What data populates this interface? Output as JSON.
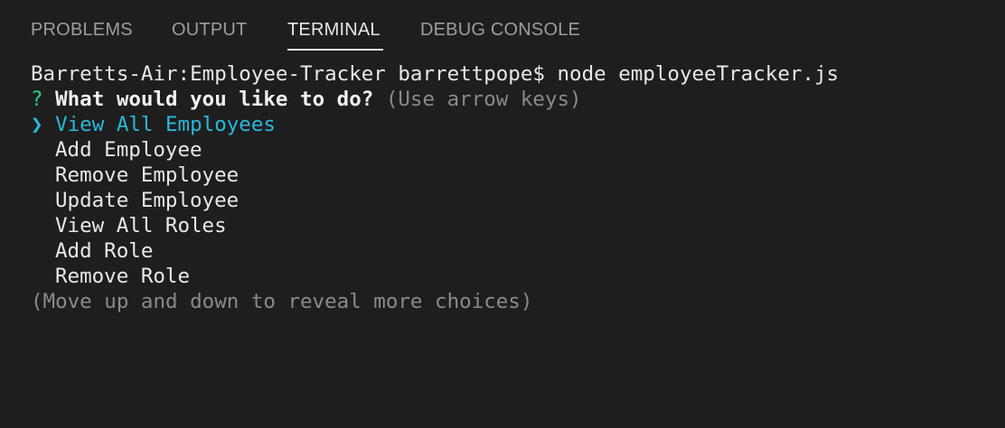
{
  "panel": {
    "tabs": [
      {
        "label": "PROBLEMS"
      },
      {
        "label": "OUTPUT"
      },
      {
        "label": "TERMINAL"
      },
      {
        "label": "DEBUG CONSOLE"
      }
    ],
    "active_tab": "TERMINAL"
  },
  "terminal": {
    "command_line": "Barretts-Air:Employee-Tracker barrettpope$ node employeeTracker.js",
    "prompt_symbol": "?",
    "question": "What would you like to do?",
    "question_hint": "(Use arrow keys)",
    "pointer_symbol": "❯",
    "selected_choice": "View All Employees",
    "choices": [
      "Add Employee",
      "Remove Employee",
      "Update Employee",
      "View All Roles",
      "Add Role",
      "Remove Role"
    ],
    "footer_hint": "(Move up and down to reveal more choices)"
  },
  "colors": {
    "background": "#1e1e1e",
    "selected": "#29b8db",
    "prompt": "#23d18b"
  }
}
